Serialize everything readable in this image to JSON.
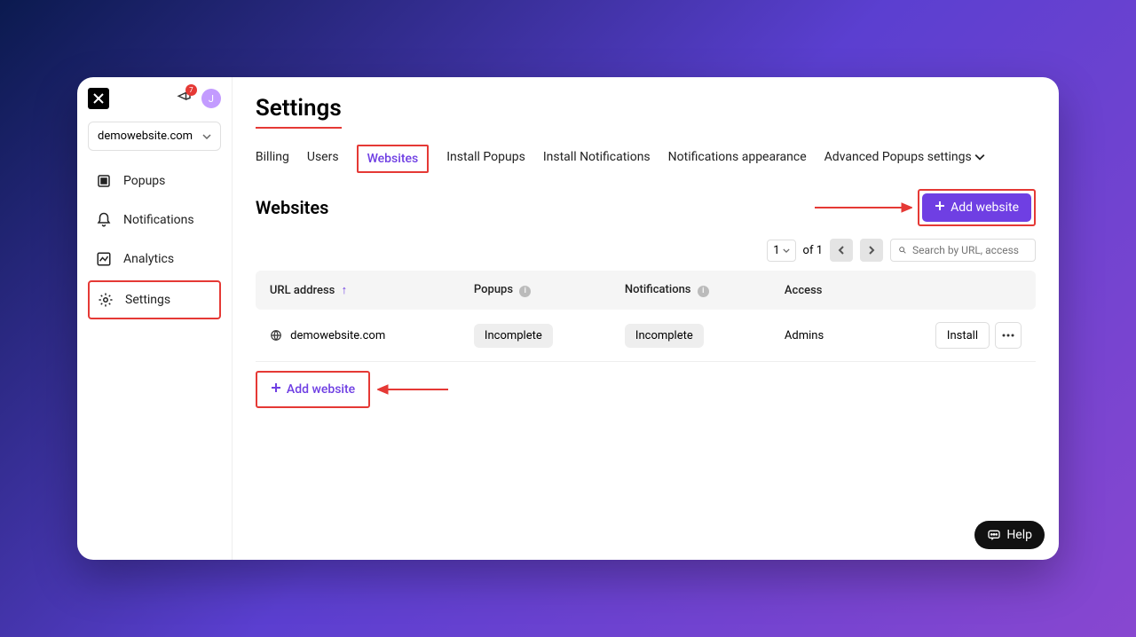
{
  "sidebar": {
    "notification_count": "7",
    "avatar_letter": "J",
    "site_selector": "demowebsite.com",
    "items": [
      {
        "label": "Popups"
      },
      {
        "label": "Notifications"
      },
      {
        "label": "Analytics"
      },
      {
        "label": "Settings"
      }
    ]
  },
  "page": {
    "title": "Settings"
  },
  "tabs": [
    {
      "label": "Billing"
    },
    {
      "label": "Users"
    },
    {
      "label": "Websites"
    },
    {
      "label": "Install Popups"
    },
    {
      "label": "Install Notifications"
    },
    {
      "label": "Notifications appearance"
    },
    {
      "label": "Advanced Popups settings"
    }
  ],
  "section": {
    "title": "Websites",
    "add_button": "Add website"
  },
  "pagination": {
    "current": "1",
    "of_label": "of 1"
  },
  "search": {
    "placeholder": "Search by URL, access"
  },
  "table": {
    "columns": {
      "url": "URL address",
      "popups": "Popups",
      "notifications": "Notifications",
      "access": "Access"
    },
    "rows": [
      {
        "url": "demowebsite.com",
        "popups": "Incomplete",
        "notifications": "Incomplete",
        "access": "Admins",
        "action": "Install"
      }
    ],
    "add_row_label": "Add website"
  },
  "help": {
    "label": "Help"
  }
}
